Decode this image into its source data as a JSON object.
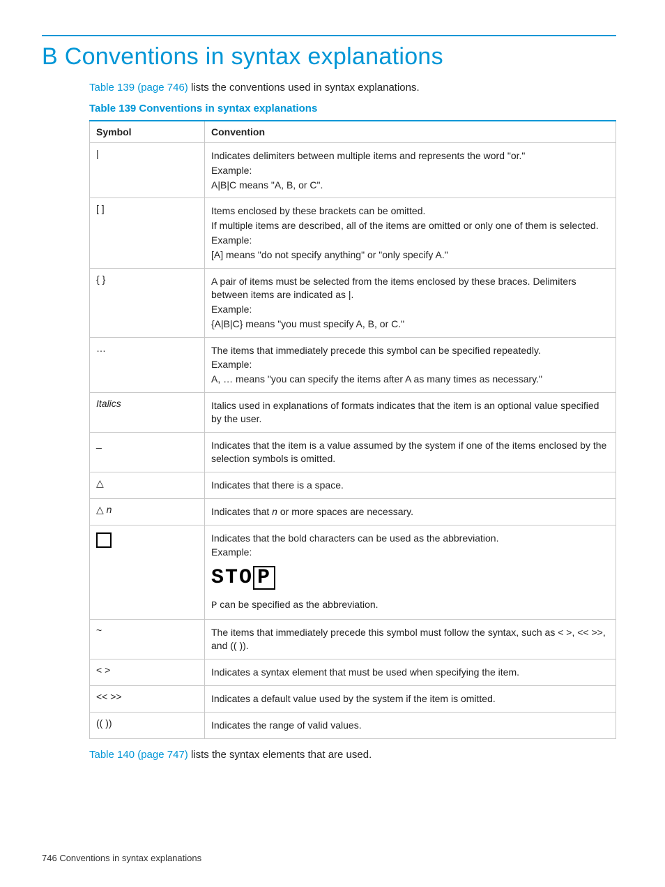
{
  "heading": "B Conventions in syntax explanations",
  "intro_link": "Table 139 (page 746)",
  "intro_rest": " lists the conventions used in syntax explanations.",
  "table_title": "Table 139 Conventions in syntax explanations",
  "table_header": {
    "symbol": "Symbol",
    "convention": "Convention"
  },
  "rows": {
    "r1_sym": "|",
    "r1_l1": "Indicates delimiters between multiple items and represents the word \"or.\"",
    "r1_l2": "Example:",
    "r1_l3": "A|B|C means \"A, B, or C\".",
    "r2_sym": "[ ]",
    "r2_l1": "Items enclosed by these brackets can be omitted.",
    "r2_l2": "If multiple items are described, all of the items are omitted or only one of them is selected.",
    "r2_l3": "Example:",
    "r2_l4": "[A] means \"do not specify anything\" or \"only specify A.\"",
    "r3_sym": "{ }",
    "r3_l1": "A pair of items must be selected from the items enclosed by these braces. Delimiters between items are indicated as |.",
    "r3_l2": "Example:",
    "r3_l3": "{A|B|C} means \"you must specify A, B, or C.\"",
    "r4_sym": "…",
    "r4_l1": "The items that immediately precede this symbol can be specified repeatedly.",
    "r4_l2": "Example:",
    "r4_l3": "A, … means \"you can specify the items after A as many times as necessary.\"",
    "r5_sym": "Italics",
    "r5_l1": "Italics used in explanations of formats indicates that the item is an optional value specified by the user.",
    "r6_sym": "_",
    "r6_l1": "Indicates that the item is a value assumed by the system if one of the items enclosed by the selection symbols is omitted.",
    "r7_sym": "△",
    "r7_l1": "Indicates that there is a space.",
    "r8_sym_pre": "△ ",
    "r8_sym_n": "n",
    "r8_l1_pre": "Indicates that ",
    "r8_l1_n": "n",
    "r8_l1_post": " or more spaces are necessary.",
    "r9_l1": "Indicates that the bold characters can be used as the abbreviation.",
    "r9_l2": "Example:",
    "r9_stop_pre": "STO",
    "r9_stop_box": "P",
    "r9_l3_pre_mono": "P",
    "r9_l3_post": " can be specified as the abbreviation.",
    "r10_sym": "~",
    "r10_l1": "The items that immediately precede this symbol must follow the syntax, such as < >, << >>, and (( )).",
    "r11_sym": "< >",
    "r11_l1": "Indicates a syntax element that must be used when specifying the item.",
    "r12_sym": "<< >>",
    "r12_l1": "Indicates a default value used by the system if the item is omitted.",
    "r13_sym": "(( ))",
    "r13_l1": "Indicates the range of valid values."
  },
  "outro_link": "Table 140 (page 747)",
  "outro_rest": " lists the syntax elements that are used.",
  "footer_page": "746",
  "footer_text": "   Conventions in syntax explanations"
}
